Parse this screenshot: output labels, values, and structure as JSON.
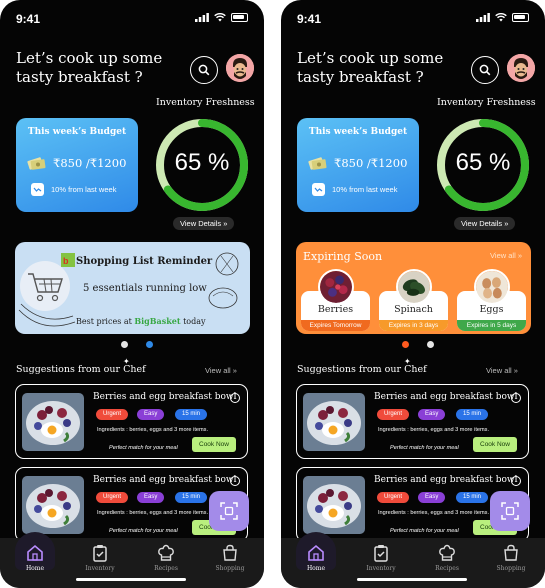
{
  "colors": {
    "budget_gradient": [
      "#5cc1f5",
      "#2f8ae8"
    ],
    "gauge_arc": "#38b62f",
    "gauge_track": "#cde9b3",
    "reminder_bg": "#c9dff3",
    "expiring_bg": "#ff8f3a",
    "urgent": "#f04b3b",
    "easy": "#8a3fd6",
    "time": "#2a73e8",
    "cook_now": "#b9ef7e",
    "scan_fab": "#a38be9"
  },
  "screens": [
    {
      "status": {
        "time": "9:41"
      },
      "greeting": "Let’s cook up some tasty breakfast ?",
      "inventory_label": "Inventory Freshness",
      "budget": {
        "title": "This week’s Budget",
        "amount": "₹850 /₹1200",
        "change": "10% from last week"
      },
      "freshness": {
        "value": 0.65,
        "text": "65 %"
      },
      "view_details": "View Details »",
      "reminder": {
        "title": "Shopping List Reminder",
        "subtitle": "5 essentials running low",
        "footer_prefix": "Best prices at",
        "brand": "BigBasket",
        "footer_suffix": "today"
      },
      "carousel_active": 1,
      "suggestions_title": "Suggestions from our Chef",
      "view_all": "View all »",
      "recipes": [
        {
          "title": "Berries and egg breakfast bowl",
          "tags": [
            "Urgent",
            "Easy",
            "15 min"
          ],
          "ingredients": "Ingredients : berries, eggs and 3 more items.",
          "note": "Perfect match for your meal",
          "cta": "Cook Now"
        },
        {
          "title": "Berries and egg breakfast bowl",
          "tags": [
            "Urgent",
            "Easy",
            "15 min"
          ],
          "ingredients": "Ingredients : berries, eggs and 3 more items.",
          "note": "Perfect match for your meal",
          "cta": "Cook Now"
        }
      ],
      "nav": [
        "Home",
        "Inventory",
        "Recipes",
        "Shopping"
      ]
    },
    {
      "status": {
        "time": "9:41"
      },
      "greeting": "Let’s cook up some tasty breakfast ?",
      "inventory_label": "Inventory Freshness",
      "budget": {
        "title": "This week’s Budget",
        "amount": "₹850 /₹1200",
        "change": "10% from last week"
      },
      "freshness": {
        "value": 0.65,
        "text": "65 %"
      },
      "view_details": "View Details »",
      "expiring": {
        "title": "Expiring Soon",
        "view_all": "View all »",
        "items": [
          {
            "name": "Berries",
            "badge": "Expires Tomorrow",
            "badge_color": "#f06a1f"
          },
          {
            "name": "Spinach",
            "badge": "Expires in 3 days",
            "badge_color": "#f79a2a"
          },
          {
            "name": "Eggs",
            "badge": "Expires in 5 days",
            "badge_color": "#3fa84a"
          }
        ]
      },
      "carousel_active": 0,
      "suggestions_title": "Suggestions from our Chef",
      "view_all": "View all »",
      "recipes": [
        {
          "title": "Berries and egg breakfast bowl",
          "tags": [
            "Urgent",
            "Easy",
            "15 min"
          ],
          "ingredients": "Ingredients : berries, eggs and 3 more items.",
          "note": "Perfect match for your meal",
          "cta": "Cook Now"
        },
        {
          "title": "Berries and egg breakfast bowl",
          "tags": [
            "Urgent",
            "Easy",
            "15 min"
          ],
          "ingredients": "Ingredients : berries, eggs and 3 more items.",
          "note": "Perfect match for your meal",
          "cta": "Cook Now"
        }
      ],
      "nav": [
        "Home",
        "Inventory",
        "Recipes",
        "Shopping"
      ]
    }
  ]
}
